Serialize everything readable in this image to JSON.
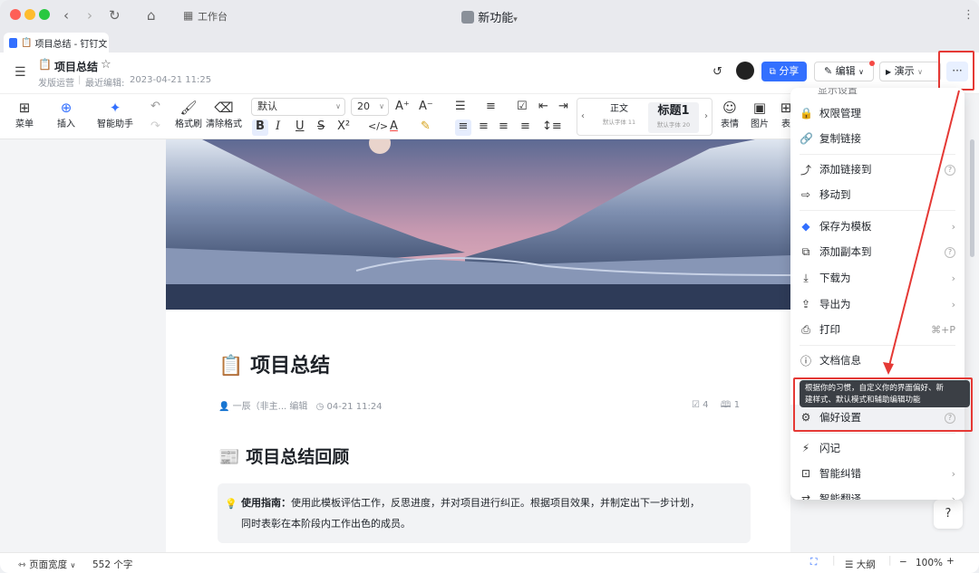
{
  "window": {
    "title": "新功能",
    "title_caret": "▾",
    "workbench": "工作台"
  },
  "tab": {
    "title": "项目总结 - 钉钉文"
  },
  "doc": {
    "title": "项目总结",
    "space": "发版运营",
    "last_edit_label": "最近编辑:",
    "last_edit_time": "2023-04-21 11:25",
    "heading": "项目总结",
    "author": "一辰（非主...",
    "author_action": "编辑",
    "date": "04-21 11:24",
    "checks_count": "4",
    "read_count": "1",
    "section_heading": "项目总结回顾",
    "callout_label": "使用指南：",
    "callout_text_1": "使用此模板评估工作，反思进度，并对项目进行纠正。根据项目效果，并制定出下一步计划，",
    "callout_text_2": "同时表彰在本阶段内工作出色的成员。"
  },
  "header_actions": {
    "share": "分享",
    "edit": "编辑",
    "present": "演示",
    "more": "···"
  },
  "toolbar": {
    "menu": "菜单",
    "insert": "插入",
    "ai": "智能助手",
    "format_painter": "格式刷",
    "clear_format": "清除格式",
    "font": "默认",
    "font_size": "20",
    "style_normal": "正文",
    "style_normal_sub": "默认字体 11",
    "style_h1": "标题1",
    "style_h1_sub": "默认字体 20",
    "emoji": "表情",
    "image": "图片",
    "table": "表"
  },
  "menu": {
    "items": [
      {
        "icon": "lock-icon",
        "label": "权限管理"
      },
      {
        "icon": "link-icon",
        "label": "复制链接"
      },
      {
        "icon": "add-link-icon",
        "label": "添加链接到"
      },
      {
        "icon": "move-icon",
        "label": "移动到"
      },
      {
        "icon": "template-icon",
        "label": "保存为模板"
      },
      {
        "icon": "copy-icon",
        "label": "添加副本到"
      },
      {
        "icon": "download-icon",
        "label": "下载为"
      },
      {
        "icon": "export-icon",
        "label": "导出为"
      },
      {
        "icon": "print-icon",
        "label": "打印",
        "shortcut": "⌘+P"
      },
      {
        "icon": "info-icon",
        "label": "文档信息"
      },
      {
        "icon": "preferences-icon",
        "label": "偏好设置"
      },
      {
        "icon": "flash-icon",
        "label": "闪记"
      },
      {
        "icon": "proofread-icon",
        "label": "智能纠错"
      },
      {
        "icon": "translate-icon",
        "label": "智能翻译"
      }
    ],
    "tooltip_1": "根据你的习惯，自定义你的界面偏好、新",
    "tooltip_2": "建样式、默认模式和辅助编辑功能",
    "cut_top": "显示设置"
  },
  "status": {
    "page_width": "页面宽度",
    "word_count": "552 个字",
    "outline": "大纲",
    "zoom": "100%"
  },
  "colors": {
    "accent": "#3370ff",
    "red": "#e53935",
    "bg": "#f3f4f6"
  }
}
